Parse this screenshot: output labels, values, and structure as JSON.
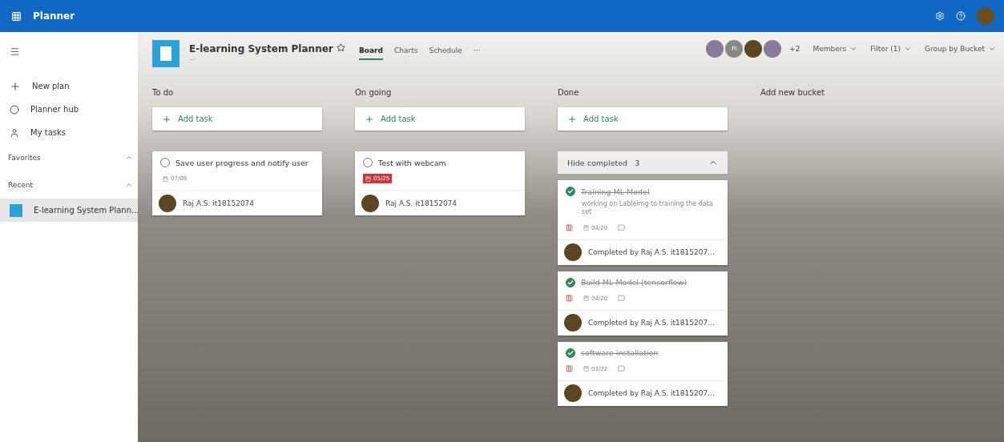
{
  "topbar": {
    "app_name": "Planner"
  },
  "sidebar": {
    "actions": [
      {
        "label": "New plan",
        "kind": "plus"
      },
      {
        "label": "Planner hub",
        "kind": "hub"
      },
      {
        "label": "My tasks",
        "kind": "person"
      }
    ],
    "sections": [
      {
        "title": "Favorites",
        "expanded": true
      },
      {
        "title": "Recent",
        "expanded": true,
        "items": [
          {
            "label": "E-learning System Plann...",
            "selected": true
          }
        ]
      }
    ]
  },
  "header": {
    "title": "E-learning System Planner",
    "more": "...",
    "tabs": [
      {
        "label": "Board",
        "selected": true
      },
      {
        "label": "Charts",
        "selected": false
      },
      {
        "label": "Schedule",
        "selected": false
      }
    ],
    "tabs_more": "···",
    "members": [
      {
        "kind": "photo"
      },
      {
        "kind": "initials",
        "initials": "PI"
      },
      {
        "kind": "photo"
      },
      {
        "kind": "photo"
      }
    ],
    "members_more": "+2",
    "controls": [
      "Members",
      "Filter (1)",
      "Group by Bucket"
    ]
  },
  "buckets": [
    {
      "title": "To do",
      "add_label": "Add task",
      "tasks": [
        {
          "title": "Save user progress and notify user",
          "completed": false,
          "date": "07/08",
          "overdue": false,
          "labeled": false,
          "commented": false,
          "footer": "Raj A.S. it18152074"
        }
      ]
    },
    {
      "title": "On going",
      "add_label": "Add task",
      "tasks": [
        {
          "title": "Test with webcam",
          "completed": false,
          "date": "05/25",
          "overdue": true,
          "labeled": false,
          "commented": false,
          "footer": "Raj A.S. it18152074"
        }
      ]
    },
    {
      "title": "Done",
      "add_label": "Add task",
      "completed_toggle": {
        "label": "Hide completed",
        "count": "3",
        "expanded": true
      },
      "tasks": [
        {
          "title": "Training ML Model",
          "completed": true,
          "description": "working on Lableimg to training the data set",
          "date": "04/20",
          "overdue": false,
          "labeled": true,
          "commented": true,
          "footer": "Completed by Raj A.S. it1815207..."
        },
        {
          "title": "Build ML Model (tensorflow)",
          "completed": true,
          "date": "04/20",
          "overdue": false,
          "labeled": true,
          "commented": true,
          "footer": "Completed by Raj A.S. it1815207..."
        },
        {
          "title": "software installation",
          "completed": true,
          "date": "03/22",
          "overdue": false,
          "labeled": true,
          "commented": true,
          "footer": "Completed by Raj A.S. it1815207..."
        }
      ]
    }
  ],
  "add_bucket": "Add new bucket"
}
